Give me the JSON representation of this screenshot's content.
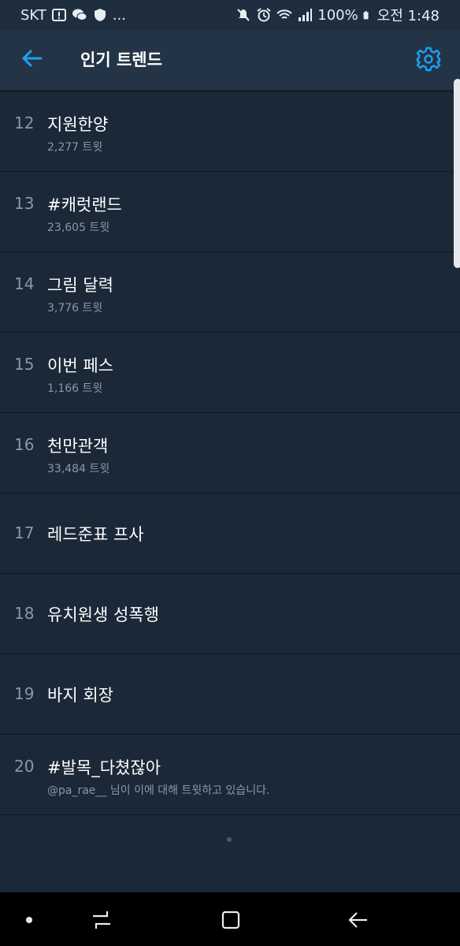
{
  "status_bar": {
    "carrier": "SKT",
    "more": "...",
    "battery": "100%",
    "time": "오전 1:48",
    "left_icons": [
      "alert-box-icon",
      "wechat-icon",
      "shield-icon"
    ],
    "right_icons": [
      "mute-icon",
      "alarm-icon",
      "wifi-icon",
      "signal-icon",
      "battery-icon"
    ]
  },
  "header": {
    "title": "인기 트렌드",
    "back_icon": "back-arrow-icon",
    "settings_icon": "gear-icon",
    "accent_color": "#1da1f2"
  },
  "trends": [
    {
      "rank": "12",
      "name": "지원한양",
      "sub": "2,277 트윗"
    },
    {
      "rank": "13",
      "name": "#캐럿랜드",
      "sub": "23,605 트윗"
    },
    {
      "rank": "14",
      "name": "그림 달력",
      "sub": "3,776 트윗"
    },
    {
      "rank": "15",
      "name": "이번 페스",
      "sub": "1,166 트윗"
    },
    {
      "rank": "16",
      "name": "천만관객",
      "sub": "33,484 트윗"
    },
    {
      "rank": "17",
      "name": "레드준표 프사",
      "sub": ""
    },
    {
      "rank": "18",
      "name": "유치원생 성폭행",
      "sub": ""
    },
    {
      "rank": "19",
      "name": "바지 회장",
      "sub": ""
    },
    {
      "rank": "20",
      "name": "#발목_다쳤잖아",
      "sub": "@pa_rae__ 님이 이에 대해 트윗하고 있습니다."
    }
  ],
  "nav_bar": {
    "icons": [
      "home-dot-icon",
      "recent-apps-icon",
      "overview-icon",
      "back-icon"
    ]
  }
}
